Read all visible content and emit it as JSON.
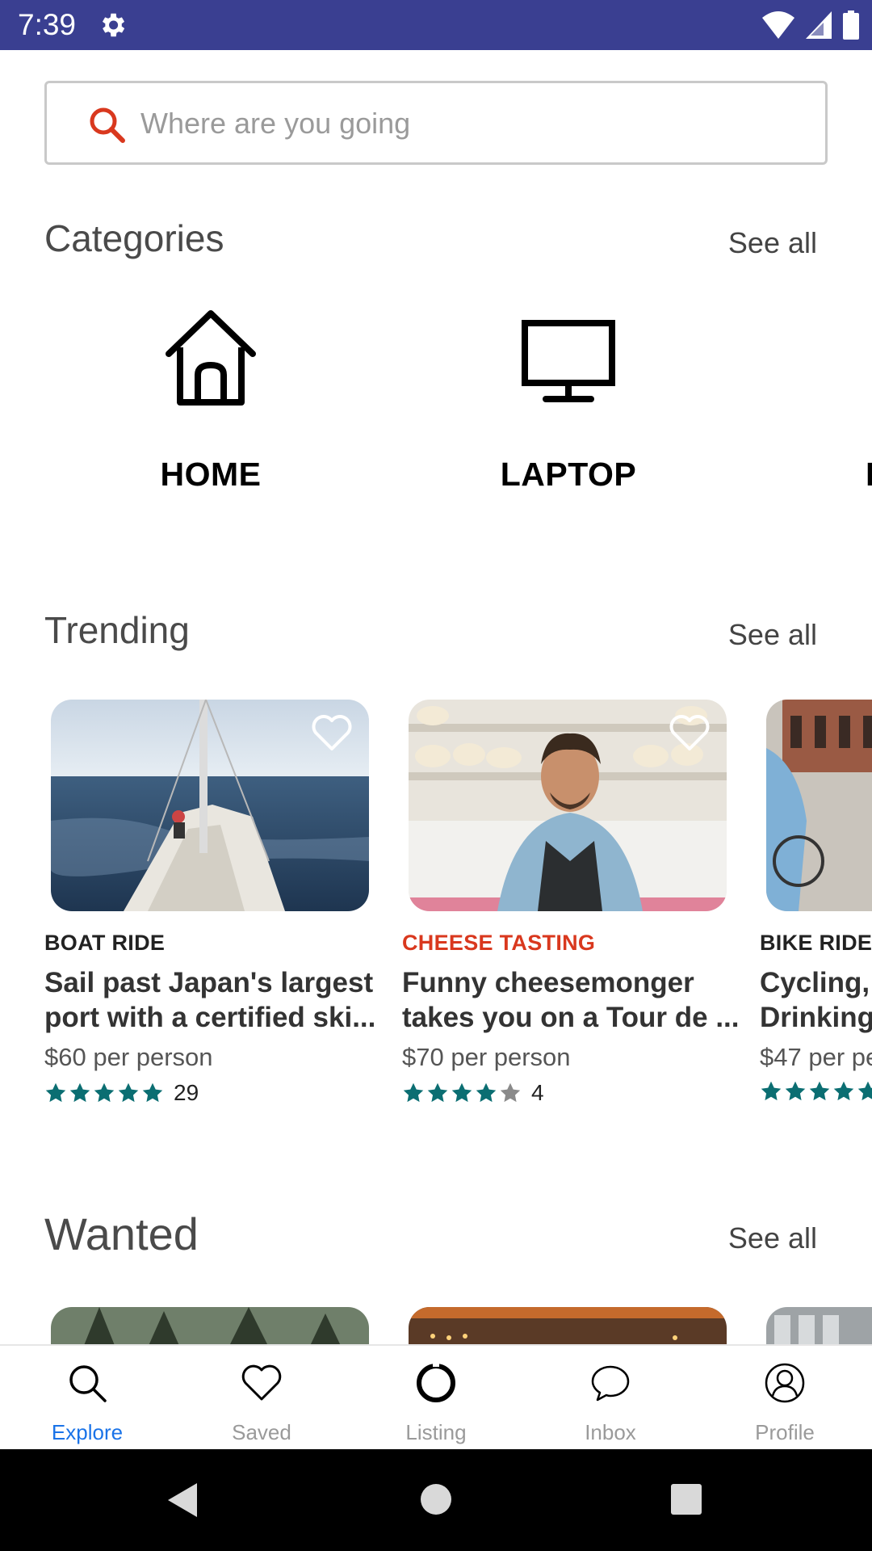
{
  "status_bar": {
    "time": "7:39"
  },
  "search": {
    "placeholder": "Where are you going"
  },
  "categories": {
    "title": "Categories",
    "see_all": "See all",
    "items": [
      {
        "label": "HOME",
        "icon": "home-icon"
      },
      {
        "label": "LAPTOP",
        "icon": "desktop-icon"
      },
      {
        "label": "I",
        "icon": ""
      }
    ]
  },
  "trending": {
    "title": "Trending",
    "see_all": "See all",
    "cards": [
      {
        "category": "BOAT RIDE",
        "category_color": "#222222",
        "title_line1": "Sail past Japan's largest",
        "title_line2": "port with a certified ski...",
        "price": "$60 per person",
        "stars": 5,
        "rating_count": "29",
        "image": "sailboat-photo"
      },
      {
        "category": "CHEESE TASTING",
        "category_color": "#d9381e",
        "title_line1": "Funny cheesemonger",
        "title_line2": "takes you on a Tour de ...",
        "price": "$70 per person",
        "stars": 4,
        "rating_count": "4",
        "image": "cheesemonger-photo"
      },
      {
        "category": "BIKE RIDE",
        "category_color": "#222222",
        "title_line1": "Cycling,",
        "title_line2": "Drinking",
        "price": "$47 per pe",
        "stars": 5,
        "rating_count": "",
        "image": "bike-photo"
      }
    ]
  },
  "wanted": {
    "title": "Wanted",
    "see_all": "See all"
  },
  "bottom_nav": {
    "items": [
      {
        "label": "Explore",
        "icon": "search-icon",
        "active": true
      },
      {
        "label": "Saved",
        "icon": "heart-icon",
        "active": false
      },
      {
        "label": "Listing",
        "icon": "ring-icon",
        "active": false
      },
      {
        "label": "Inbox",
        "icon": "chat-bubble-icon",
        "active": false
      },
      {
        "label": "Profile",
        "icon": "profile-icon",
        "active": false
      }
    ]
  },
  "colors": {
    "status_bar": "#3a3f91",
    "accent_search": "#d9381e",
    "star_filled": "#0b6e72",
    "star_empty": "#8a8a8a",
    "nav_active": "#1a73e8"
  }
}
